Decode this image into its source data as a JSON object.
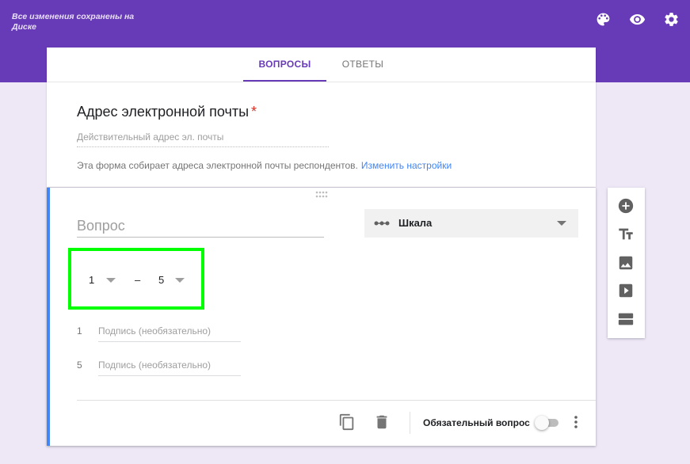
{
  "header": {
    "save_status": "Все изменения сохранены на Диске",
    "icons": [
      "palette-icon",
      "preview-eye-icon",
      "settings-gear-icon"
    ],
    "accent_color": "#673ab7",
    "background_color": "#ede7f6"
  },
  "tabs": {
    "questions": "ВОПРОСЫ",
    "answers": "ОТВЕТЫ",
    "active": "questions"
  },
  "email_block": {
    "title": "Адрес электронной почты",
    "required_mark": "*",
    "placeholder": "Действительный адрес эл. почты",
    "note": "Эта форма собирает адреса электронной почты респондентов.",
    "settings_link": "Изменить настройки"
  },
  "question": {
    "title_placeholder": "Вопрос",
    "type_label": "Шкала",
    "type_icon": "linear-scale-icon",
    "range_from": "1",
    "range_dash": "–",
    "range_to": "5",
    "highlight_color": "#00ff00",
    "labels": [
      {
        "num": "1",
        "placeholder": "Подпись (необязательно)"
      },
      {
        "num": "5",
        "placeholder": "Подпись (необязательно)"
      }
    ],
    "required_label": "Обязательный вопрос",
    "required_on": false,
    "accent_bar_color": "#4285f4"
  },
  "side_toolbar": {
    "buttons": [
      "add-question-icon",
      "add-title-icon",
      "add-image-icon",
      "add-video-icon",
      "add-section-icon"
    ]
  }
}
